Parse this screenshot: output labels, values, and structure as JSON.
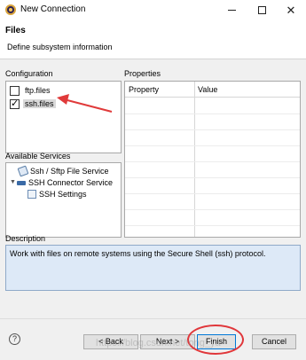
{
  "window": {
    "title": "New Connection"
  },
  "header": {
    "title": "Files",
    "description": "Define subsystem information"
  },
  "configuration": {
    "label": "Configuration",
    "items": [
      {
        "label": "ftp.files",
        "checked": false
      },
      {
        "label": "ssh.files",
        "checked": true
      }
    ]
  },
  "properties": {
    "label": "Properties",
    "columns": [
      "Property",
      "Value"
    ]
  },
  "services": {
    "label": "Available Services",
    "items": [
      {
        "label": "Ssh / Sftp File Service",
        "icon": "file-service-icon"
      },
      {
        "label": "SSH Connector Service",
        "icon": "connector-icon"
      },
      {
        "label": "SSH Settings",
        "icon": "settings-icon"
      }
    ]
  },
  "description": {
    "label": "Description",
    "text": "Work with files on remote systems using the Secure Shell (ssh) protocol."
  },
  "buttons": {
    "help": "?",
    "back": "< Back",
    "next": "Next >",
    "finish": "Finish",
    "cancel": "Cancel"
  },
  "watermark": "https://blog.csdn.net/tong_ya"
}
